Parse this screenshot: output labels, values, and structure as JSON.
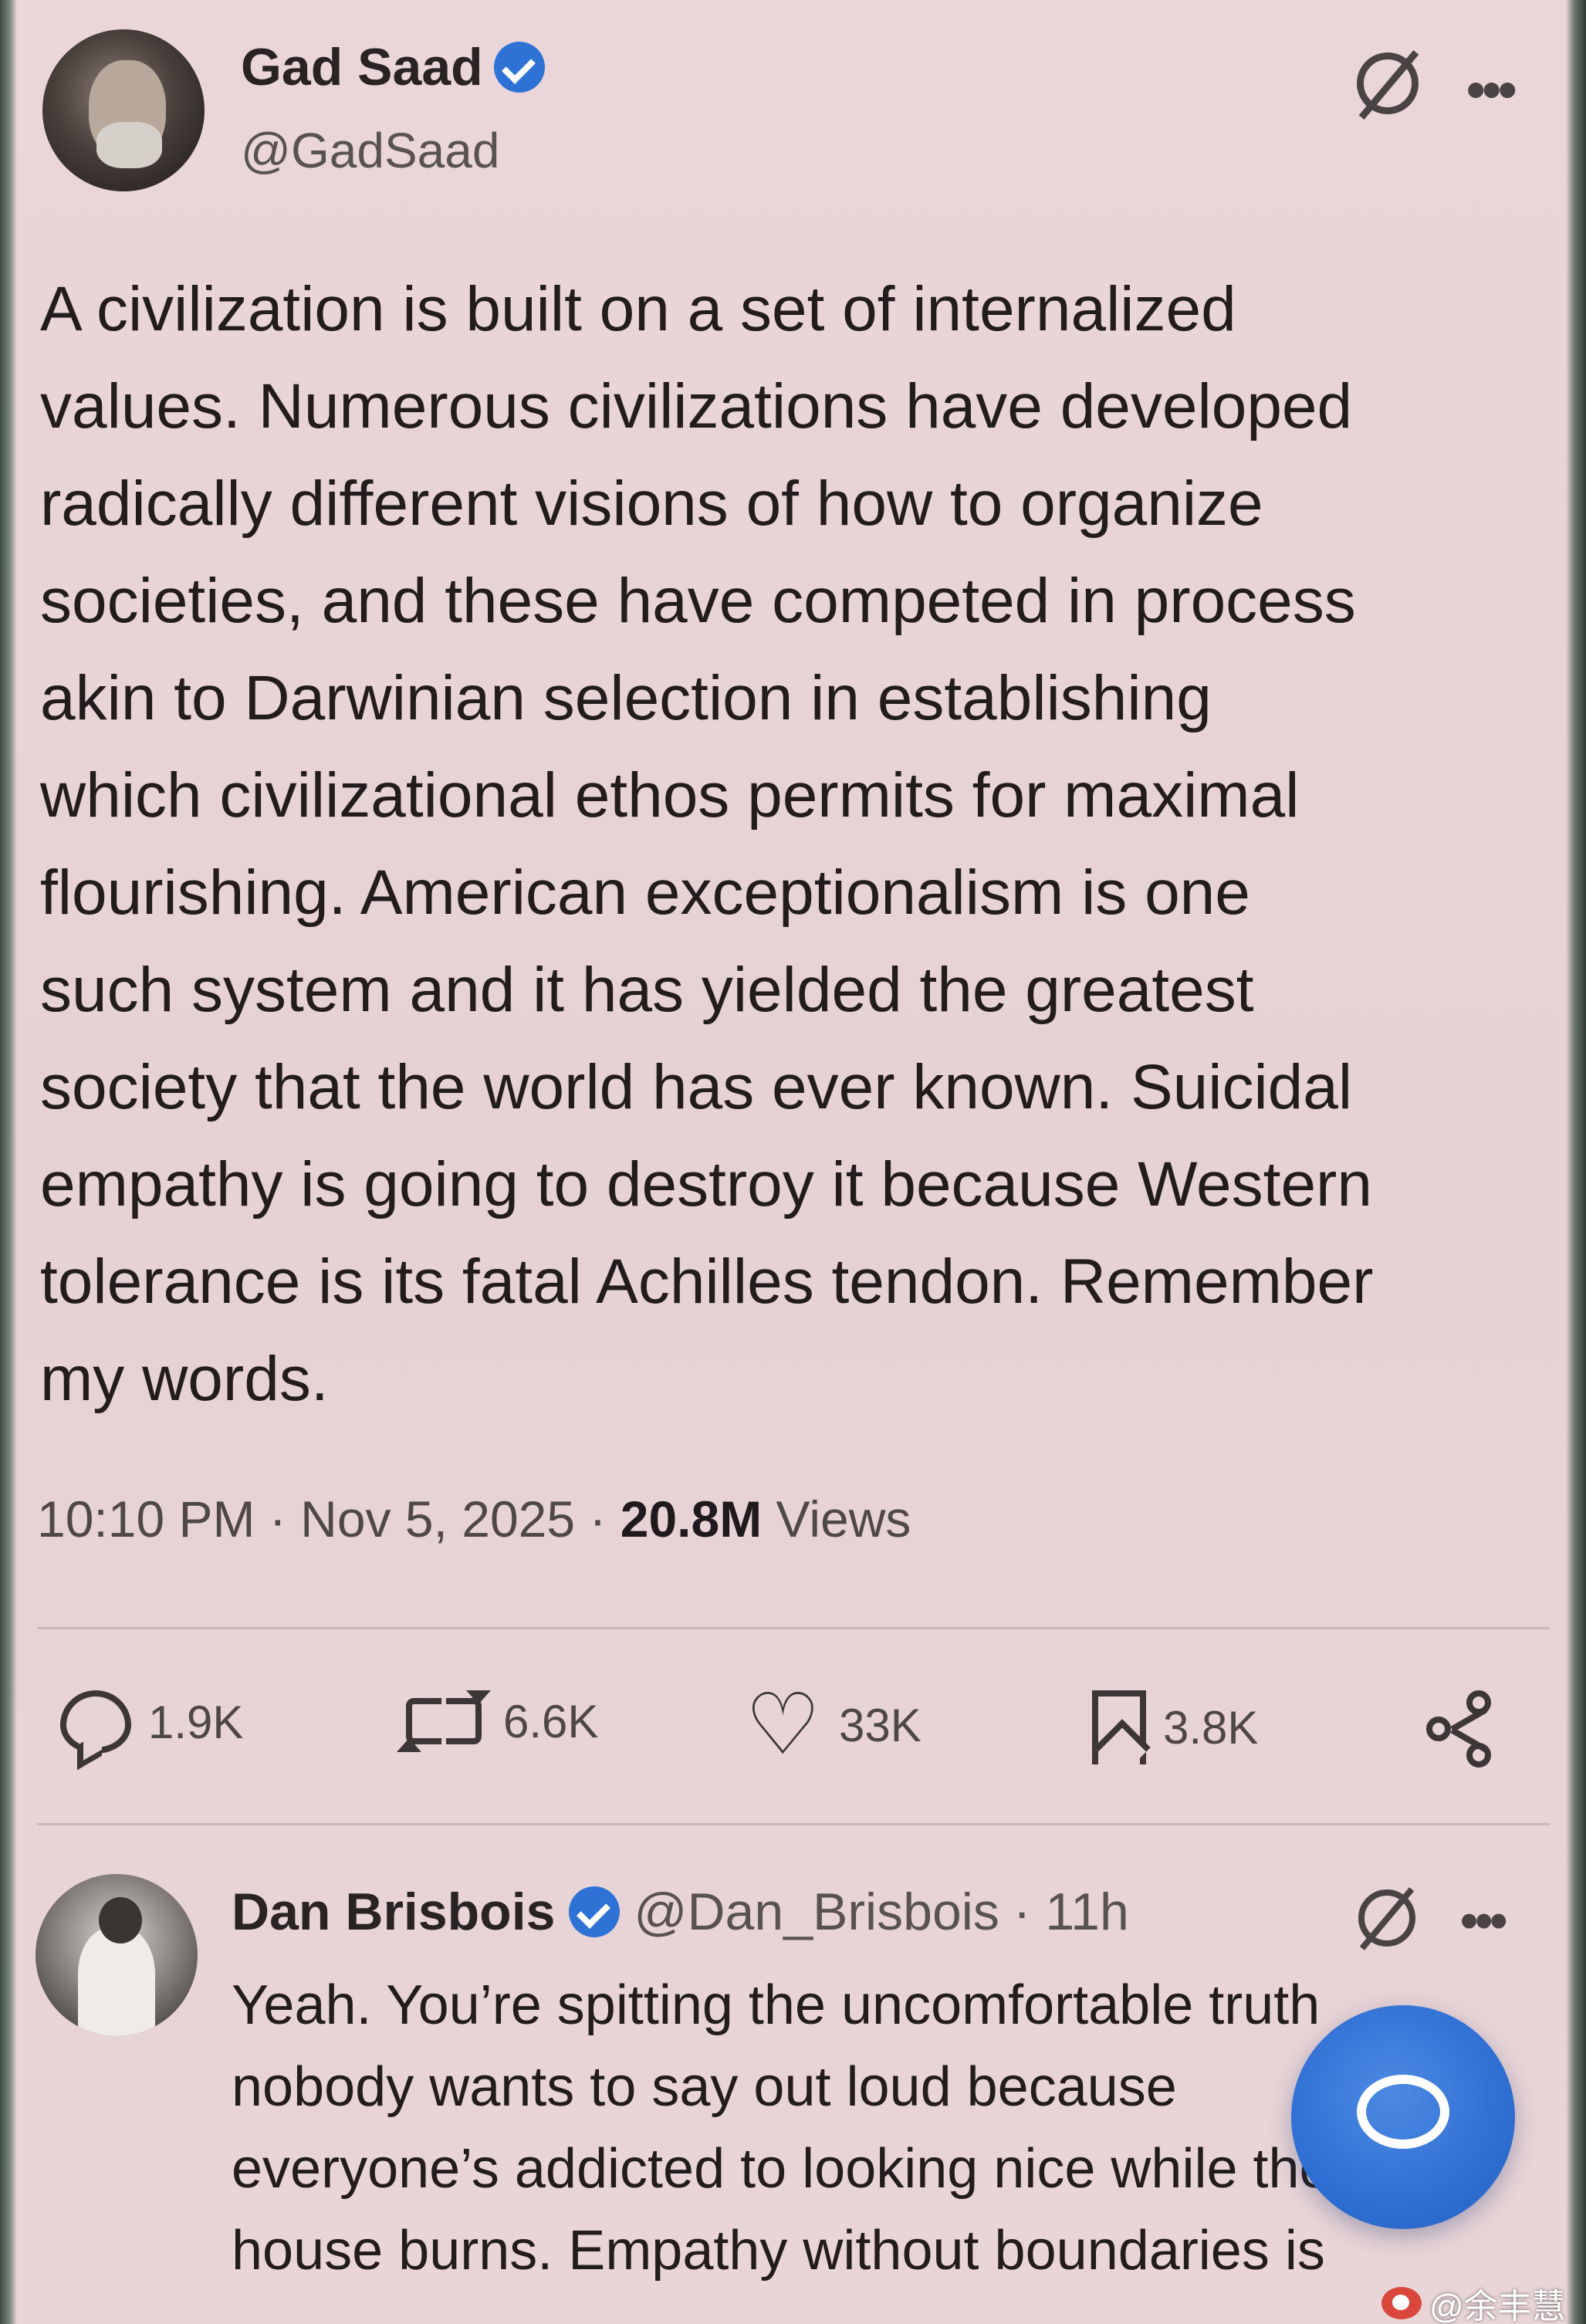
{
  "main_tweet": {
    "author_name": "Gad Saad",
    "handle": "@GadSaad",
    "text": "A civilization is built on a set of internalized\nvalues.  Numerous civilizations have developed\nradically different visions of how to organize\nsocieties, and these have competed in process\nakin to Darwinian selection in establishing\nwhich civilizational ethos permits for maximal\nflourishing.  American exceptionalism is one\nsuch system and it has yielded the greatest\nsociety that the world has ever known.  Suicidal\nempathy is going to destroy it because Western\ntolerance is its fatal Achilles tendon. Remember\nmy words.",
    "time": "10:10 PM",
    "date": "Nov 5, 2025",
    "views_count": "20.8M",
    "views_label": "Views",
    "replies": "1.9K",
    "reposts": "6.6K",
    "likes": "33K",
    "bookmarks": "3.8K"
  },
  "reply": {
    "author_name": "Dan Brisbois",
    "handle": "@Dan_Brisbois",
    "age": "· 11h",
    "text": "Yeah. You’re spitting the uncomfortable truth\nnobody wants to say out loud because\neveryone’s addicted to looking nice while the\nhouse burns. Empathy without boundaries is"
  },
  "watermark": "@余丰慧",
  "icons": {
    "verified": "verified-badge-icon",
    "grok": "grok-icon",
    "more": "more-icon",
    "reply": "reply-icon",
    "repost": "repost-icon",
    "like": "heart-icon",
    "bookmark": "bookmark-icon",
    "share": "share-icon",
    "compose": "compose-reply-icon"
  },
  "colors": {
    "background": "#e8d3d6",
    "verified": "#2f72d6",
    "fab": "#2f6fd3"
  }
}
